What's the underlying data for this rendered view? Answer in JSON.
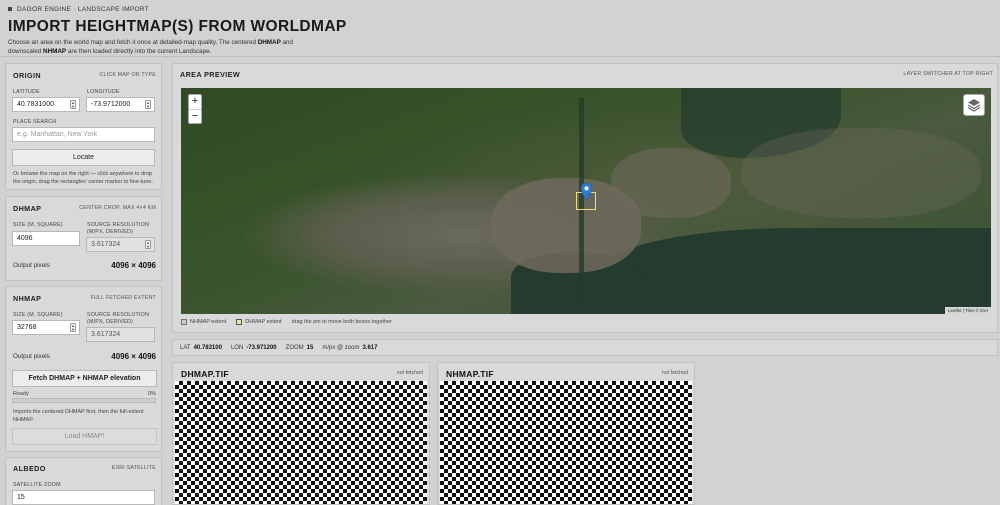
{
  "header": {
    "app_line": "DAGOR ENGINE · LANDSCAPE IMPORT",
    "title": "IMPORT HEIGHTMAP(S) FROM WORLDMAP",
    "desc_1": "Choose an area on the world map and fetch it once at detailed-map quality. The centered ",
    "desc_b1": "DHMAP",
    "desc_2": " and downscaled ",
    "desc_b2": "NHMAP",
    "desc_3": " are then loaded directly into the current Landscape."
  },
  "origin": {
    "title": "ORIGIN",
    "hint": "CLICK MAP OR TYPE",
    "lat_label": "LATITUDE",
    "lat_value": "40.7831000",
    "lon_label": "LONGITUDE",
    "lon_value": "-73.9712000",
    "place_label": "PLACE SEARCH",
    "place_placeholder": "e.g. Manhattan, New York",
    "locate_label": "Locate",
    "note": "Or browse the map on the right — click anywhere to drop the origin, drag the rectangles' center marker to fine-tune."
  },
  "dhmap": {
    "title": "DHMAP",
    "hint": "CENTER CROP, MAX 4×4 KM",
    "size_label": "SIZE (M, SQUARE)",
    "size_value": "4096",
    "res_label": "SOURCE RESOLUTION (M/PX, DERIVED)",
    "res_value": "3.617324",
    "output_label": "Output pixels",
    "output_value": "4096 × 4096"
  },
  "nhmap": {
    "title": "NHMAP",
    "hint": "FULL FETCHED EXTENT",
    "size_label": "SIZE (M, SQUARE)",
    "size_value": "32768",
    "res_label": "SOURCE RESOLUTION (M/PX, DERIVED)",
    "res_value": "3.617324",
    "output_label": "Output pixels",
    "output_value": "4096 × 4096",
    "fetch_label": "Fetch DHMAP + NHMAP elevation",
    "status_label": "Ready",
    "status_percent": "0%",
    "progress": 0,
    "note": "Imports the centered DHMAP first, then the full-extent NHMAP.",
    "load_label": "Load HMAP!"
  },
  "albedo": {
    "title": "ALBEDO",
    "hint": "ESRI SATELLITE",
    "zoom_label": "SATELLITE ZOOM",
    "zoom_value": "15"
  },
  "preview": {
    "title": "AREA PREVIEW",
    "hint": "LAYER SWITCHER AT TOP RIGHT",
    "zoom_in": "+",
    "zoom_out": "−",
    "attribution": "Leaflet | Tiles © Esri",
    "legend_nhmap": "NHMAP extent",
    "legend_dhmap": "DHMAP extent",
    "legend_note": "drag the pin to move both boxes together"
  },
  "coords": {
    "lat_label": "LAT",
    "lat_value": "40.783100",
    "lon_label": "LON",
    "lon_value": "-73.971200",
    "zoom_label": "ZOOM",
    "zoom_value": "15",
    "mpx_label": "m/px @ zoom",
    "mpx_value": "3.617"
  },
  "tiles": {
    "dhmap_title": "DHMAP.TIF",
    "dhmap_status": "not fetched",
    "nhmap_title": "NHMAP.TIF",
    "nhmap_status": "not fetched"
  },
  "icons": [
    "layers-icon",
    "map-pin-icon",
    "spinner-icon",
    "app-square-icon"
  ]
}
